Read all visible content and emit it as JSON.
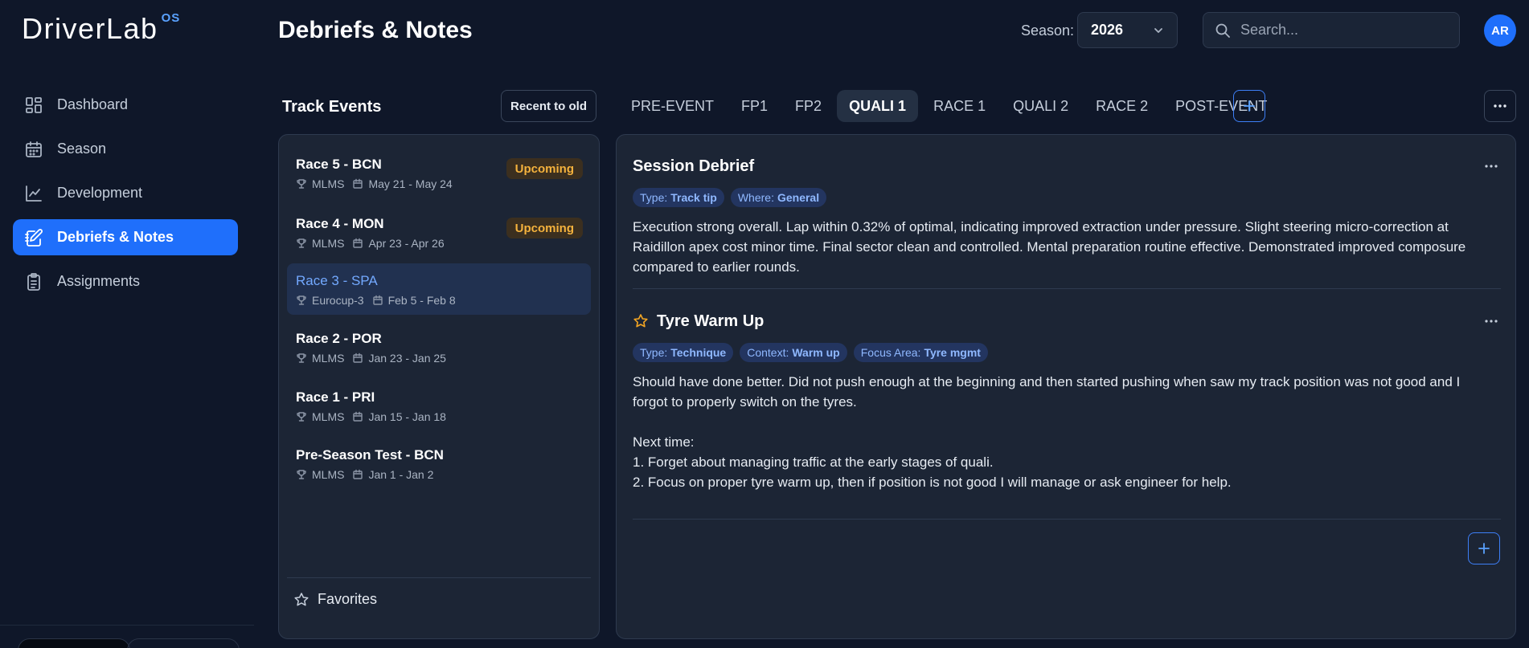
{
  "app": {
    "logo_text": "DriverLab",
    "logo_superscript": "OS"
  },
  "sidebar": {
    "items": [
      {
        "label": "Dashboard",
        "icon": "dashboard-icon",
        "active": false
      },
      {
        "label": "Season",
        "icon": "calendar-icon",
        "active": false
      },
      {
        "label": "Development",
        "icon": "chart-line-icon",
        "active": false
      },
      {
        "label": "Debriefs & Notes",
        "icon": "notebook-pen-icon",
        "active": true
      },
      {
        "label": "Assignments",
        "icon": "clipboard-icon",
        "active": false
      }
    ]
  },
  "header": {
    "title": "Debriefs & Notes",
    "season_label": "Season:",
    "season_value": "2026",
    "search_placeholder": "Search...",
    "avatar_initials": "AR"
  },
  "events": {
    "title": "Track Events",
    "sort_label": "Recent to old",
    "items": [
      {
        "name": "Race 5 - BCN",
        "series": "MLMS",
        "dates": "May 21 - May 24",
        "badge": "Upcoming"
      },
      {
        "name": "Race 4 - MON",
        "series": "MLMS",
        "dates": "Apr 23 - Apr 26",
        "badge": "Upcoming"
      },
      {
        "name": "Race 3 - SPA",
        "series": "Eurocup-3",
        "dates": "Feb 5 - Feb 8",
        "badge": "",
        "selected": true
      },
      {
        "name": "Race 2 - POR",
        "series": "MLMS",
        "dates": "Jan 23 - Jan 25",
        "badge": ""
      },
      {
        "name": "Race 1 - PRI",
        "series": "MLMS",
        "dates": "Jan 15 - Jan 18",
        "badge": ""
      },
      {
        "name": "Pre-Season Test - BCN",
        "series": "MLMS",
        "dates": "Jan 1 - Jan 2",
        "badge": ""
      }
    ],
    "favorites_label": "Favorites"
  },
  "tabs": [
    {
      "label": "PRE-EVENT",
      "active": false
    },
    {
      "label": "FP1",
      "active": false
    },
    {
      "label": "FP2",
      "active": false
    },
    {
      "label": "QUALI 1",
      "active": true
    },
    {
      "label": "RACE 1",
      "active": false
    },
    {
      "label": "QUALI 2",
      "active": false
    },
    {
      "label": "RACE 2",
      "active": false
    },
    {
      "label": "POST-EVENT",
      "active": false
    }
  ],
  "notes": [
    {
      "title": "Session Debrief",
      "favorite": false,
      "tags": [
        {
          "key": "Type:",
          "value": "Track tip"
        },
        {
          "key": "Where:",
          "value": "General"
        }
      ],
      "body": "Execution strong overall. Lap within 0.32% of optimal, indicating improved extraction under pressure. Slight steering micro-correction at Raidillon apex cost minor time. Final sector clean and controlled. Mental preparation routine effective. Demonstrated improved composure compared to earlier rounds."
    },
    {
      "title": "Tyre Warm Up",
      "favorite": true,
      "tags": [
        {
          "key": "Type:",
          "value": "Technique"
        },
        {
          "key": "Context:",
          "value": "Warm up"
        },
        {
          "key": "Focus Area:",
          "value": "Tyre mgmt"
        }
      ],
      "body": "Should have done better. Did not push enough at the beginning and then started pushing when saw my track position was not good and I forgot to properly switch on the tyres.\n\nNext time:\n1. Forget about managing traffic at the early stages of quali.\n2. Focus on proper tyre warm up, then if position is not good I will manage or ask engineer for help."
    }
  ],
  "colors": {
    "background": "#0f1729",
    "panel": "#1c2535",
    "accent": "#1f6ffb",
    "upcoming": "#f4b23d",
    "favorite_star": "#f4a623"
  }
}
